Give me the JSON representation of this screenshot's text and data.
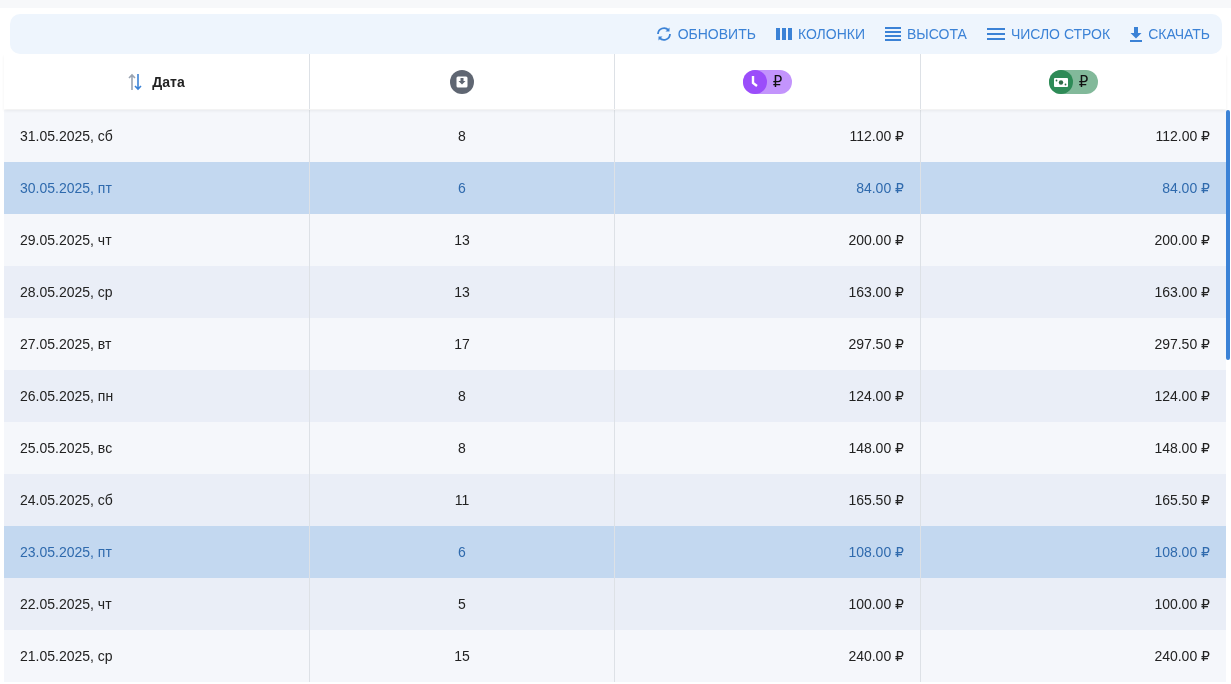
{
  "toolbar": [
    {
      "kind": "refresh",
      "label": "ОБНОВИТЬ"
    },
    {
      "kind": "columns",
      "label": "КОЛОНКИ"
    },
    {
      "kind": "density",
      "label": "ВЫСОТА"
    },
    {
      "kind": "rows",
      "label": "ЧИСЛО СТРОК"
    },
    {
      "kind": "download",
      "label": "СКАЧАТЬ"
    }
  ],
  "table": {
    "columns": [
      {
        "kind": "sort",
        "label": "Дата"
      },
      {
        "kind": "inbox"
      },
      {
        "kind": "clockchip",
        "text": "₽",
        "color": "#9b4dfa"
      },
      {
        "kind": "cashchip",
        "text": "₽",
        "color": "#2e8b57"
      }
    ],
    "rows": [
      {
        "selected": false,
        "cells": [
          "31.05.2025, сб",
          "8",
          "112.00 ₽",
          "112.00 ₽"
        ]
      },
      {
        "selected": true,
        "cells": [
          "30.05.2025, пт",
          "6",
          "84.00 ₽",
          "84.00 ₽"
        ]
      },
      {
        "selected": false,
        "cells": [
          "29.05.2025, чт",
          "13",
          "200.00 ₽",
          "200.00 ₽"
        ]
      },
      {
        "selected": false,
        "cells": [
          "28.05.2025, ср",
          "13",
          "163.00 ₽",
          "163.00 ₽"
        ]
      },
      {
        "selected": false,
        "cells": [
          "27.05.2025, вт",
          "17",
          "297.50 ₽",
          "297.50 ₽"
        ]
      },
      {
        "selected": false,
        "cells": [
          "26.05.2025, пн",
          "8",
          "124.00 ₽",
          "124.00 ₽"
        ]
      },
      {
        "selected": false,
        "cells": [
          "25.05.2025, вс",
          "8",
          "148.00 ₽",
          "148.00 ₽"
        ]
      },
      {
        "selected": false,
        "cells": [
          "24.05.2025, сб",
          "11",
          "165.50 ₽",
          "165.50 ₽"
        ]
      },
      {
        "selected": true,
        "cells": [
          "23.05.2025, пт",
          "6",
          "108.00 ₽",
          "108.00 ₽"
        ]
      },
      {
        "selected": false,
        "cells": [
          "22.05.2025, чт",
          "5",
          "100.00 ₽",
          "100.00 ₽"
        ]
      },
      {
        "selected": false,
        "cells": [
          "21.05.2025, ср",
          "15",
          "240.00 ₽",
          "240.00 ₽"
        ]
      }
    ]
  }
}
